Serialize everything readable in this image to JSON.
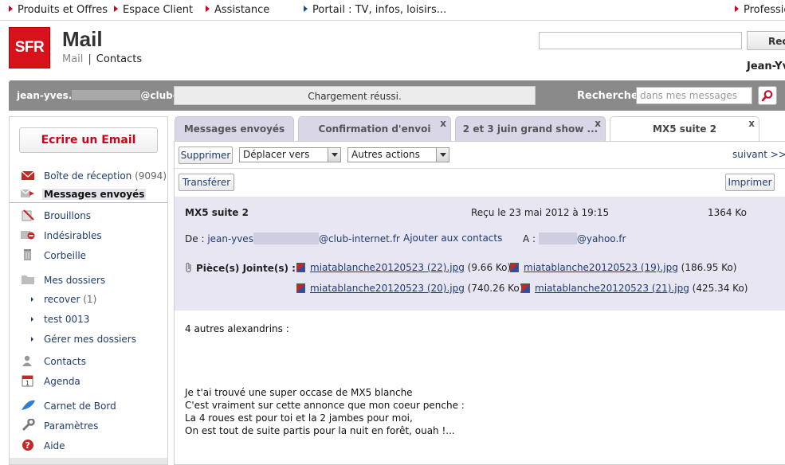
{
  "topnav": {
    "items": [
      "Produits et Offres",
      "Espace Client",
      "Assistance",
      "Portail : TV, infos, loisirs...",
      "Professio"
    ]
  },
  "header": {
    "logo_text": "SFR",
    "title": "Mail",
    "subnav_mail": "Mail",
    "subnav_sep": "|",
    "subnav_contacts": "Contacts",
    "search_button": "Rec",
    "user": "Jean-Yv"
  },
  "statusbar": {
    "email_prefix": "jean-yves.",
    "email_suffix": "@club-in",
    "message": "Chargement réussi.",
    "search_label": "Rechercher",
    "search_placeholder": "dans mes messages"
  },
  "sidebar": {
    "compose": "Ecrire un Email",
    "inbox": {
      "label": "Boîte de réception",
      "count": "(9094)"
    },
    "sent": "Messages envoyés",
    "drafts": "Brouillons",
    "spam": "Indésirables",
    "trash": "Corbeille",
    "folders": "Mes dossiers",
    "sub": [
      {
        "label": "recover",
        "count": "(1)"
      },
      {
        "label": "test 0013",
        "count": ""
      },
      {
        "label": "Gérer mes dossiers",
        "count": ""
      }
    ],
    "contacts": "Contacts",
    "agenda": "Agenda",
    "logbook": "Carnet de Bord",
    "settings": "Paramètres",
    "help": "Aide"
  },
  "tabs": [
    {
      "label": "Messages envoyés"
    },
    {
      "label": "Confirmation d'envoi",
      "close": "x"
    },
    {
      "label": "2 et 3 juin grand show ...",
      "close": "x"
    },
    {
      "label": "MX5 suite 2",
      "close": "x"
    }
  ],
  "toolbar": {
    "delete": "Supprimer",
    "move": "Déplacer vers",
    "other": "Autres actions",
    "next": "suivant >>",
    "forward": "Transférer",
    "print": "Imprimer"
  },
  "message": {
    "subject": "MX5 suite 2",
    "received": "Reçu le 23 mai 2012 à 19:15",
    "size": "1364 Ko",
    "from_label": "De :",
    "from_prefix": "jean-yves",
    "from_suffix": "@club-internet.fr",
    "add_contact": "Ajouter aux contacts",
    "to_label": "A :",
    "to_suffix": "@yahoo.fr",
    "attach_label": "Pièce(s) Jointe(s) :",
    "attachments": [
      {
        "name": "miatablanche20120523 (22).jpg",
        "size": "(9.66 Ko)"
      },
      {
        "name": "miatablanche20120523 (19).jpg",
        "size": "(186.95 Ko)"
      },
      {
        "name": "miatablanche20120523 (20).jpg",
        "size": "(740.26 Ko)"
      },
      {
        "name": "miatablanche20120523 (21).jpg",
        "size": "(425.34 Ko)"
      }
    ],
    "body": [
      "4 autres alexandrins :",
      "Je t'ai trouvé une super occase de MX5 blanche",
      "C'est vraiment sur cette annonce que mon coeur penche  :",
      "La 4 roues est pour toi et la 2 jambes pour moi,",
      "On est tout de suite partis pour la nuit en forêt, ouah !..."
    ]
  },
  "colors": {
    "brand": "#d8121b",
    "accent": "#1f3c6e",
    "status_bar": "#8a8a8a",
    "header_bg": "#e8e6f2"
  }
}
